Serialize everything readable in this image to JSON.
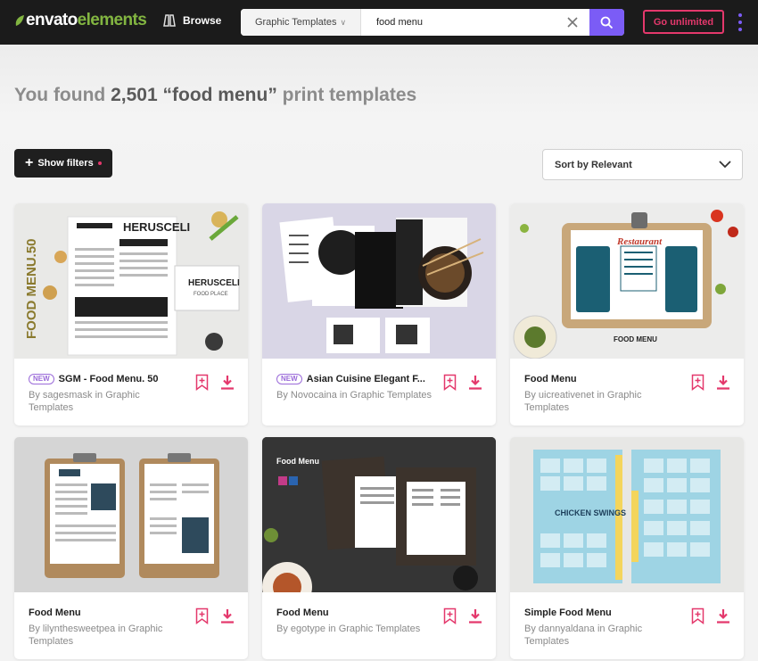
{
  "header": {
    "logo_prefix": "envato",
    "logo_suffix": "elements",
    "browse_label": "Browse",
    "search_category": "Graphic Templates",
    "search_value": "food menu",
    "go_unlimited_label": "Go unlimited",
    "colors": {
      "accent": "#7b5cf6",
      "brand": "#82b541",
      "cta": "#e4386c"
    }
  },
  "results": {
    "prefix": "You found",
    "count": "2,501",
    "query": "“food menu”",
    "suffix": "print templates"
  },
  "controls": {
    "show_filters_label": "Show filters",
    "sort_label": "Sort by Relevant"
  },
  "items": [
    {
      "badge": "NEW",
      "title": "SGM - Food Menu. 50",
      "byline": "By sagesmask in Graphic Templates"
    },
    {
      "badge": "NEW",
      "title": "Asian Cuisine Elegant F...",
      "byline": "By Novocaina in Graphic Templates"
    },
    {
      "title": "Food Menu",
      "byline": "By uicreativenet in Graphic Templates"
    },
    {
      "title": "Food Menu",
      "byline": "By lilynthesweetpea in Graphic Templates"
    },
    {
      "title": "Food Menu",
      "byline": "By egotype in Graphic Templates"
    },
    {
      "title": "Simple Food Menu",
      "byline": "By dannyaldana in Graphic Templates"
    }
  ],
  "thumb_text": {
    "t1_vertical": "FOOD MENU.50",
    "t1_brand": "HERUSCELI",
    "t1_brand_sub": "FOOD PLACE",
    "t3_script": "Restaurant",
    "t3_caption": "FOOD MENU",
    "t5_label": "Food Menu",
    "t6_headline": "CHICKEN SWINGS"
  }
}
